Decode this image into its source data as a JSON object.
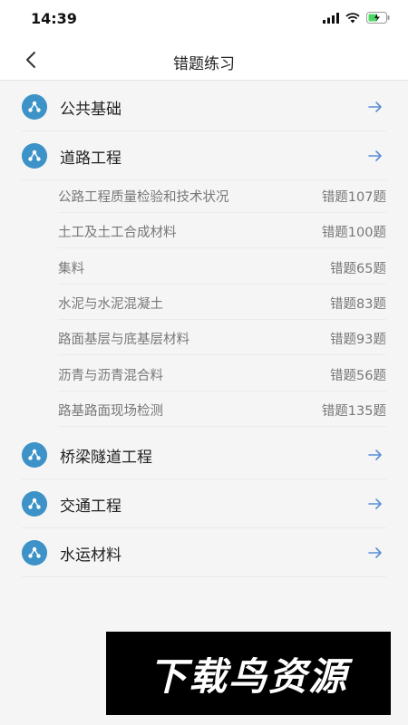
{
  "status_bar": {
    "time": "14:39"
  },
  "header": {
    "title": "错题练习"
  },
  "categories": [
    {
      "label": "公共基础"
    },
    {
      "label": "道路工程"
    },
    {
      "label": "桥梁隧道工程"
    },
    {
      "label": "交通工程"
    },
    {
      "label": "水运材料"
    }
  ],
  "road_subitems": [
    {
      "label": "公路工程质量检验和技术状况",
      "count": "错题107题"
    },
    {
      "label": "土工及土工合成材料",
      "count": "错题100题"
    },
    {
      "label": "集料",
      "count": "错题65题"
    },
    {
      "label": "水泥与水泥混凝土",
      "count": "错题83题"
    },
    {
      "label": "路面基层与底基层材料",
      "count": "错题93题"
    },
    {
      "label": "沥青与沥青混合料",
      "count": "错题56题"
    },
    {
      "label": "路基路面现场检测",
      "count": "错题135题"
    }
  ],
  "watermark": {
    "text": "下载鸟资源"
  },
  "colors": {
    "accent": "#3d93c8",
    "arrow": "#5b8fd6"
  },
  "icons": [
    "signal-icon",
    "wifi-icon",
    "battery-icon",
    "back-icon",
    "category-icon",
    "arrow-right-icon"
  ]
}
